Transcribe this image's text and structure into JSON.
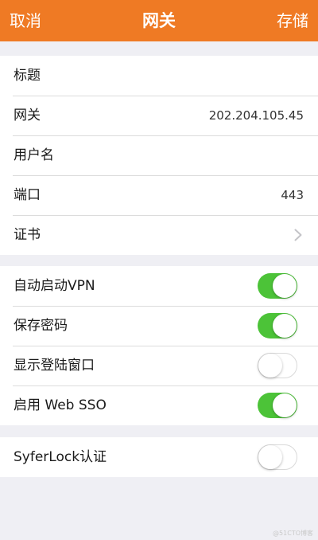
{
  "navbar": {
    "cancel_label": "取消",
    "title": "网关",
    "save_label": "存储"
  },
  "fields": [
    {
      "label": "标题",
      "value": ""
    },
    {
      "label": "网关",
      "value": "202.204.105.45"
    },
    {
      "label": "用户名",
      "value": ""
    },
    {
      "label": "端口",
      "value": "443"
    },
    {
      "label": "证书",
      "value": ""
    }
  ],
  "options": [
    {
      "label": "自动启动VPN",
      "enabled": true
    },
    {
      "label": "保存密码",
      "enabled": true
    },
    {
      "label": "显示登陆窗口",
      "enabled": false
    },
    {
      "label": "启用 Web SSO",
      "enabled": true
    }
  ],
  "syferlock": {
    "label": "SyferLock认证",
    "enabled": false
  },
  "watermark": "@51CTO博客",
  "colors": {
    "accent": "#ef7a24",
    "toggle_on": "#4cc338",
    "background": "#efeff4"
  }
}
